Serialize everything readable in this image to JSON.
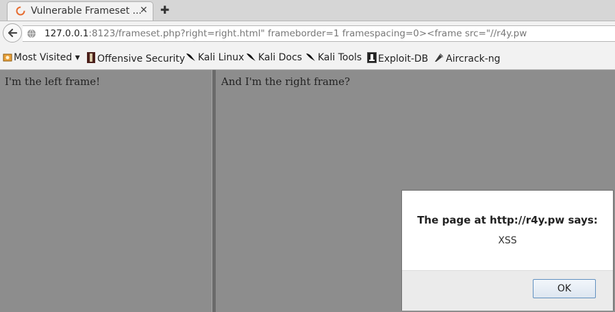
{
  "tab": {
    "title": "Vulnerable Frameset ...",
    "close": "✕",
    "favicon": "firefox-loading-icon"
  },
  "newtab": "✚",
  "url": {
    "host": "127.0.0.1",
    "rest": ":8123/frameset.php?right=right.html\" frameborder=1 framespacing=0><frame src=\"//r4y.pw"
  },
  "bookmarks": [
    {
      "label": "Most Visited ▾",
      "icon": "most-visited-icon"
    },
    {
      "label": "Offensive Security",
      "icon": "offsec-icon"
    },
    {
      "label": "Kali Linux",
      "icon": "kali-dragon-icon"
    },
    {
      "label": "Kali Docs",
      "icon": "kali-dragon-icon"
    },
    {
      "label": "Kali Tools",
      "icon": "kali-dragon-icon"
    },
    {
      "label": "Exploit-DB",
      "icon": "exploitdb-icon"
    },
    {
      "label": "Aircrack-ng",
      "icon": "aircrack-icon"
    }
  ],
  "frames": {
    "left_text": "I'm the left frame!",
    "right_text": "And I'm the right frame?"
  },
  "dialog": {
    "title": "The page at http://r4y.pw says:",
    "message": "XSS",
    "ok": "OK"
  },
  "colors": {
    "frame_bg": "#8d8d8d",
    "dialog_bg": "#ffffff",
    "ok_border": "#5f8fbf"
  }
}
